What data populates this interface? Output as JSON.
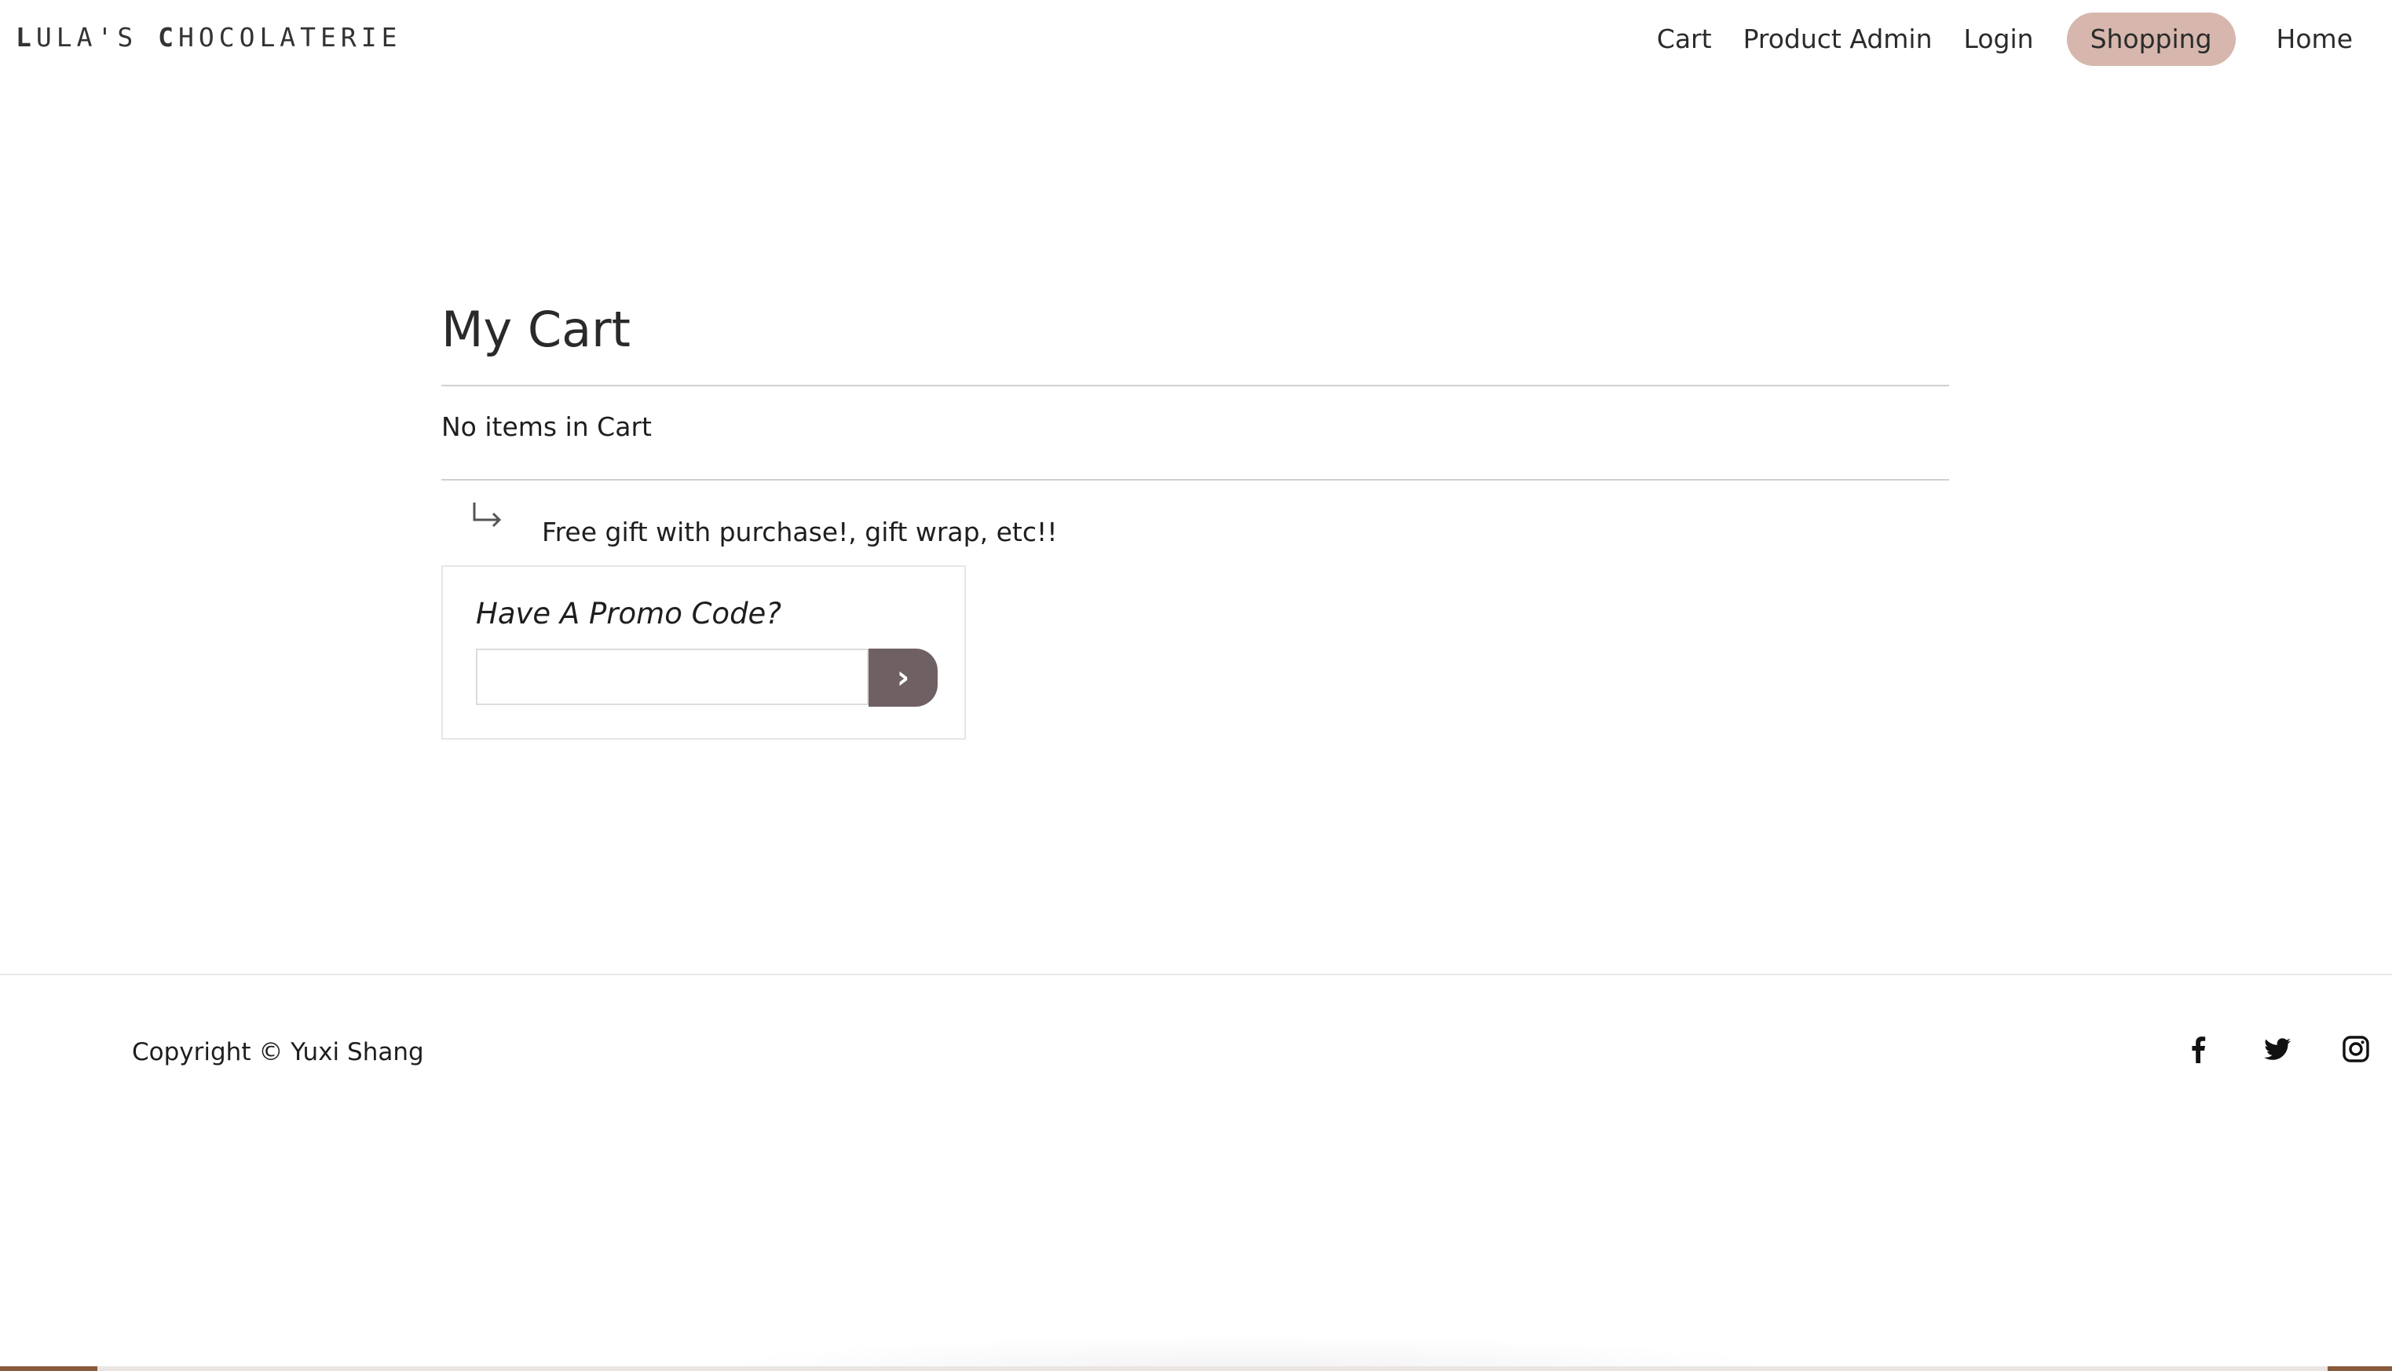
{
  "header": {
    "brand": {
      "first_cap": "L",
      "first_rest": "ULA'S ",
      "second_cap": "C",
      "second_rest": "HOCOLATERIE"
    },
    "nav": {
      "cart": "Cart",
      "product_admin": "Product Admin",
      "login": "Login",
      "shopping": "Shopping",
      "home": "Home"
    },
    "active_nav": "Shopping",
    "accent_color": "#d7b7ad"
  },
  "cart": {
    "title": "My Cart",
    "empty_message": "No items in Cart",
    "promo_note": "Free gift with purchase!, gift wrap, etc!!",
    "promo_heading": "Have A Promo Code?",
    "promo_input_value": "",
    "promo_submit_label": "›",
    "promo_button_color": "#6f6163"
  },
  "footer": {
    "copyright": "Copyright © Yuxi Shang",
    "social": [
      {
        "name": "facebook",
        "icon": "facebook-icon"
      },
      {
        "name": "twitter",
        "icon": "twitter-icon"
      },
      {
        "name": "instagram",
        "icon": "instagram-icon"
      }
    ]
  }
}
